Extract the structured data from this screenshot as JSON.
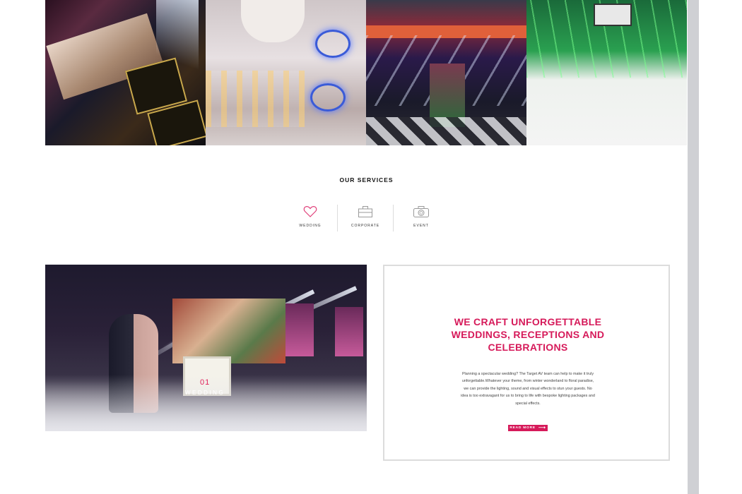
{
  "gallery": {
    "tiles": [
      {
        "name": "gallery-photo-screens"
      },
      {
        "name": "gallery-photo-dj-booth"
      },
      {
        "name": "gallery-photo-venue-lighting"
      },
      {
        "name": "gallery-photo-dancefloor"
      }
    ]
  },
  "services": {
    "title": "OUR SERVICES",
    "items": [
      {
        "label": "WEDDING",
        "icon": "heart-icon",
        "color": "#e0407a"
      },
      {
        "label": "CORPORATE",
        "icon": "briefcase-icon",
        "color": "#9a9a9a"
      },
      {
        "label": "EVENT",
        "icon": "camera-icon",
        "color": "#9a9a9a"
      }
    ]
  },
  "feature": {
    "number": "01",
    "caption": "WEDDING",
    "heading_lines": [
      "WE CRAFT UNFORGETTABLE",
      "WEDDINGS, RECEPTIONS AND",
      "CELEBRATIONS"
    ],
    "body_lines": [
      "Planning a spectacular wedding? The Target AV team can help to make it truly",
      "unforgettable.Whatever your theme, from winter wonderland to floral paradise,",
      "we can provide the lighting, sound and visual effects to stun your guests. No",
      "idea is too extravagant for us to bring to life with bespoke lighting packages and",
      "special effects."
    ],
    "read_more": "READ MORE",
    "accent_color": "#d61a5a"
  }
}
